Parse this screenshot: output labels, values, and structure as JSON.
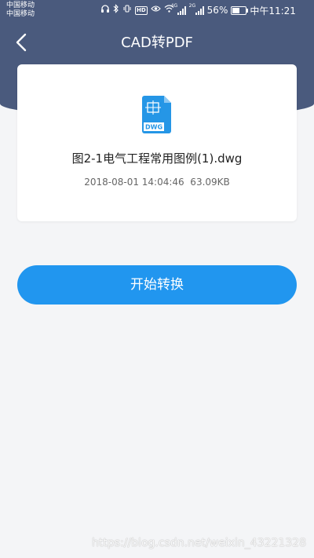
{
  "status_bar": {
    "carrier_1": "中国移动",
    "carrier_2": "中国移动",
    "battery_percent": "56%",
    "battery_level": 0.56,
    "time": "中午11:21",
    "hd_label": "HD",
    "network_4g": "4G",
    "network_2g": "2G"
  },
  "nav": {
    "title": "CAD转PDF",
    "back_icon": "chevron-left-icon"
  },
  "file": {
    "icon": "dwg-file-icon",
    "icon_label": "DWG",
    "name": "图2-1电气工程常用图例(1).dwg",
    "meta": "2018-08-01 14:04:46  63.09KB"
  },
  "actions": {
    "start_label": "开始转换"
  },
  "watermark": {
    "text": "https://blog.csdn.net/weixin_43221328"
  },
  "colors": {
    "header": "#4a5a7d",
    "accent": "#2196ef",
    "background": "#f4f5f7",
    "card": "#ffffff"
  }
}
